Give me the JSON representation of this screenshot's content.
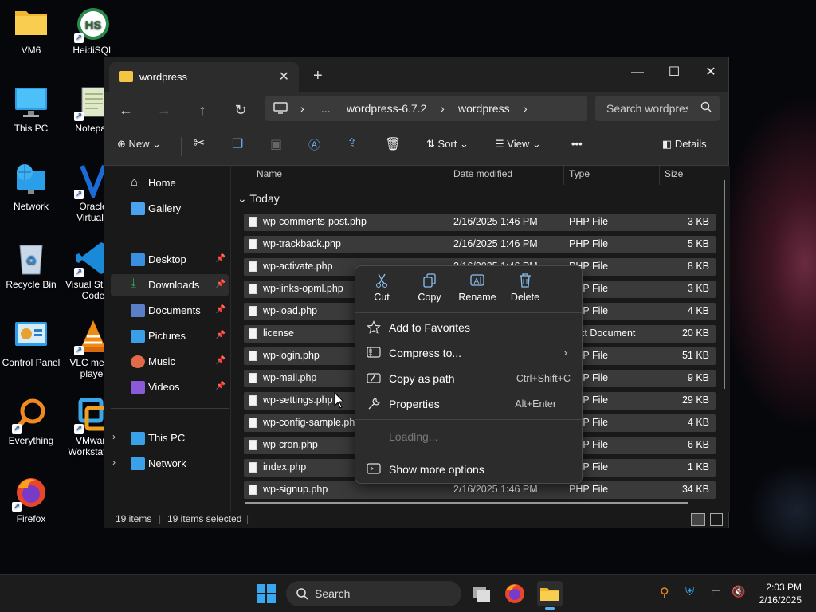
{
  "desktop": {
    "icons": [
      {
        "label": "VM6",
        "icon": "folder-icon"
      },
      {
        "label": "HeidiSQL",
        "icon": "heidisql-icon"
      },
      {
        "label": "This PC",
        "icon": "monitor-icon"
      },
      {
        "label": "Notepad",
        "icon": "notepad-icon"
      },
      {
        "label": "Network",
        "icon": "network-icon"
      },
      {
        "label": "Oracle VirtualB",
        "icon": "virtualbox-icon"
      },
      {
        "label": "Recycle Bin",
        "icon": "recycle-bin-icon"
      },
      {
        "label": "Visual Studio Code",
        "icon": "vscode-icon"
      },
      {
        "label": "Control Panel",
        "icon": "control-panel-icon"
      },
      {
        "label": "VLC media player",
        "icon": "vlc-icon"
      },
      {
        "label": "Everything",
        "icon": "search-app-icon"
      },
      {
        "label": "VMware Workstation",
        "icon": "vmware-icon"
      },
      {
        "label": "Firefox",
        "icon": "firefox-icon"
      }
    ]
  },
  "window": {
    "tab_title": "wordpress",
    "new_tab": "+",
    "controls": {
      "minimize": "—",
      "maximize": "☐",
      "close": "✕"
    }
  },
  "address": {
    "crumbs": [
      "...",
      "wordpress-6.7.2",
      "wordpress"
    ],
    "search_placeholder": "Search wordpress"
  },
  "commandbar": {
    "new_label": "New",
    "sort_label": "Sort",
    "view_label": "View",
    "more_label": "•••",
    "details_label": "Details"
  },
  "nav": {
    "items": [
      {
        "label": "Home",
        "icon": "home-icon",
        "color": "#e8e8e8"
      },
      {
        "label": "Gallery",
        "icon": "gallery-icon",
        "color": "#4aa3f0"
      },
      {
        "label": "Desktop",
        "icon": "desktop-icon",
        "color": "#3a8fe0",
        "pinned": true
      },
      {
        "label": "Downloads",
        "icon": "downloads-icon",
        "color": "#2e9e5a",
        "pinned": true
      },
      {
        "label": "Documents",
        "icon": "documents-icon",
        "color": "#5a7fc8",
        "pinned": true
      },
      {
        "label": "Pictures",
        "icon": "pictures-icon",
        "color": "#3a9ee8",
        "pinned": true
      },
      {
        "label": "Music",
        "icon": "music-icon",
        "color": "#e06a4a",
        "pinned": true
      },
      {
        "label": "Videos",
        "icon": "videos-icon",
        "color": "#8a5ad8",
        "pinned": true
      },
      {
        "label": "This PC",
        "icon": "this-pc-icon",
        "color": "#3aa0e8"
      },
      {
        "label": "Network",
        "icon": "network-icon",
        "color": "#3aa0e8"
      }
    ],
    "selected": "Downloads"
  },
  "files": {
    "columns": [
      "Name",
      "Date modified",
      "Type",
      "Size"
    ],
    "group": "Today",
    "rows": [
      {
        "name": "wp-comments-post.php",
        "date": "2/16/2025 1:46 PM",
        "type": "PHP File",
        "size": "3 KB"
      },
      {
        "name": "wp-trackback.php",
        "date": "2/16/2025 1:46 PM",
        "type": "PHP File",
        "size": "5 KB"
      },
      {
        "name": "wp-activate.php",
        "date": "2/16/2025 1:46 PM",
        "type": "PHP File",
        "size": "8 KB"
      },
      {
        "name": "wp-links-opml.php",
        "date": "",
        "type": "PHP File",
        "size": "3 KB"
      },
      {
        "name": "wp-load.php",
        "date": "",
        "type": "PHP File",
        "size": "4 KB"
      },
      {
        "name": "license",
        "date": "",
        "type": "Text Document",
        "size": "20 KB"
      },
      {
        "name": "wp-login.php",
        "date": "",
        "type": "PHP File",
        "size": "51 KB"
      },
      {
        "name": "wp-mail.php",
        "date": "",
        "type": "PHP File",
        "size": "9 KB"
      },
      {
        "name": "wp-settings.php",
        "date": "",
        "type": "PHP File",
        "size": "29 KB"
      },
      {
        "name": "wp-config-sample.php",
        "date": "",
        "type": "PHP File",
        "size": "4 KB"
      },
      {
        "name": "wp-cron.php",
        "date": "",
        "type": "PHP File",
        "size": "6 KB"
      },
      {
        "name": "index.php",
        "date": "",
        "type": "PHP File",
        "size": "1 KB"
      },
      {
        "name": "wp-signup.php",
        "date": "2/16/2025 1:46 PM",
        "type": "PHP File",
        "size": "34 KB"
      }
    ]
  },
  "status": {
    "count": "19 items",
    "selected": "19 items selected"
  },
  "context_menu": {
    "quick_actions": [
      {
        "label": "Cut",
        "icon": "cut-icon"
      },
      {
        "label": "Copy",
        "icon": "copy-icon"
      },
      {
        "label": "Rename",
        "icon": "rename-icon"
      },
      {
        "label": "Delete",
        "icon": "delete-icon"
      }
    ],
    "items": [
      {
        "label": "Add to Favorites",
        "icon": "star-icon",
        "shortcut": ""
      },
      {
        "label": "Compress to...",
        "icon": "zip-icon",
        "shortcut": "",
        "arrow": "›"
      },
      {
        "label": "Copy as path",
        "icon": "copy-path-icon",
        "shortcut": "Ctrl+Shift+C"
      },
      {
        "label": "Properties",
        "icon": "properties-icon",
        "shortcut": "Alt+Enter"
      }
    ],
    "loading": "Loading...",
    "more_options": "Show more options"
  },
  "taskbar": {
    "search_label": "Search",
    "time": "2:03 PM",
    "date": "2/16/2025"
  }
}
